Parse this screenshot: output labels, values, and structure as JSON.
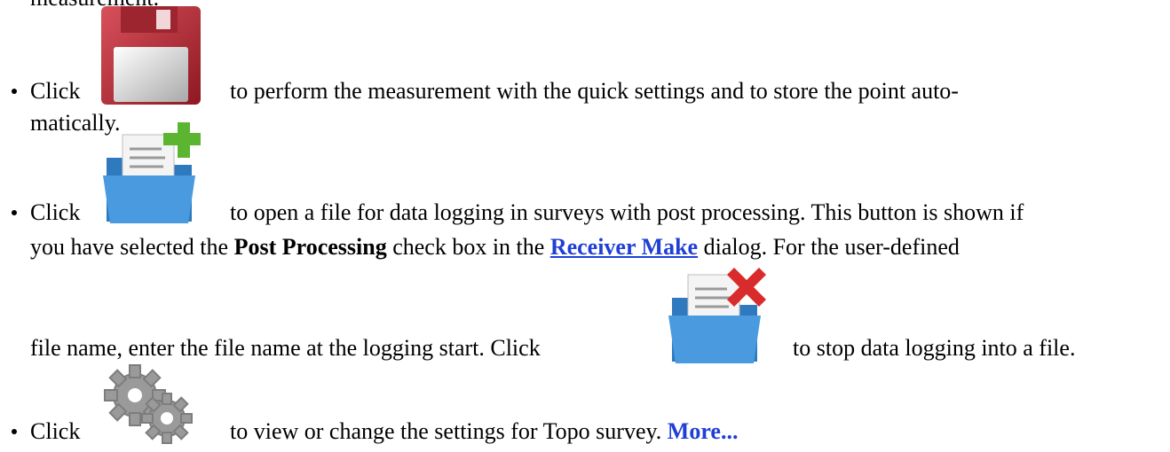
{
  "top_fragment": "measurement.",
  "items": [
    {
      "click": "Click",
      "icon": "save-floppy-icon",
      "text_1": "to perform the measurement with the quick settings and to store the point auto-",
      "text_2": "matically."
    },
    {
      "click": "Click",
      "icon": "open-log-file-icon",
      "text_1": "to open a file for data logging in surveys with post processing. This button is shown if",
      "text_2a": "you have selected the ",
      "bold_1": "Post Processing",
      "text_2b": " check box in the ",
      "link_1": "Receiver Make",
      "text_2c": " dialog. For the user-defined",
      "text_3a": "file name, enter the file name at the logging start. Click",
      "icon_2": "close-log-file-icon",
      "text_3b": "to stop data logging into a file."
    },
    {
      "click": "Click",
      "icon": "settings-gears-icon",
      "text_1": "to view or change the settings for Topo survey.",
      "more": "More..."
    }
  ],
  "colors": {
    "link": "#1f3fd6",
    "floppy": "#b0232f",
    "folder": "#3f8fd1",
    "plus": "#5cb531",
    "cross": "#d92b2b",
    "gear": "#9a9a9a"
  }
}
